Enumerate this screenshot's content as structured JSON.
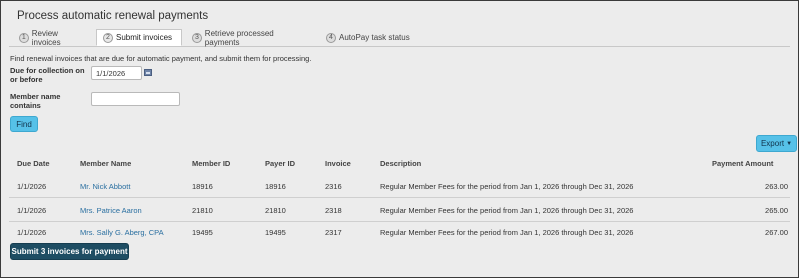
{
  "page": {
    "title": "Process automatic renewal payments",
    "intro": "Find renewal invoices that are due for automatic payment, and submit them for processing."
  },
  "tabs": [
    {
      "num": "1",
      "label": "Review invoices",
      "active": false
    },
    {
      "num": "2",
      "label": "Submit invoices",
      "active": true
    },
    {
      "num": "3",
      "label": "Retrieve processed payments",
      "active": false
    },
    {
      "num": "4",
      "label": "AutoPay task status",
      "active": false
    }
  ],
  "filters": {
    "due_label_line1": "Due for collection on",
    "due_label_line2": "or before",
    "due_value": "1/1/2026",
    "member_label_line1": "Member name",
    "member_label_line2": "contains",
    "member_value": "",
    "find_label": "Find"
  },
  "export_label": "Export",
  "table": {
    "headers": {
      "due_date": "Due Date",
      "member_name": "Member Name",
      "member_id": "Member ID",
      "payer_id": "Payer ID",
      "invoice": "Invoice",
      "description": "Description",
      "payment_amount": "Payment Amount"
    },
    "rows": [
      {
        "due_date": "1/1/2026",
        "member_name": "Mr. Nick Abbott",
        "member_id": "18916",
        "payer_id": "18916",
        "invoice": "2316",
        "description": "Regular Member Fees for the period from Jan 1, 2026 through Dec 31, 2026",
        "amount": "263.00"
      },
      {
        "due_date": "1/1/2026",
        "member_name": "Mrs. Patrice Aaron",
        "member_id": "21810",
        "payer_id": "21810",
        "invoice": "2318",
        "description": "Regular Member Fees for the period from Jan 1, 2026 through Dec 31, 2026",
        "amount": "265.00"
      },
      {
        "due_date": "1/1/2026",
        "member_name": "Mrs. Sally G. Aberg, CPA",
        "member_id": "19495",
        "payer_id": "19495",
        "invoice": "2317",
        "description": "Regular Member Fees for the period from Jan 1, 2026 through Dec 31, 2026",
        "amount": "267.00"
      }
    ]
  },
  "submit_label": "Submit 3 invoices for payment",
  "colors": {
    "accent_button": "#56c1e8",
    "primary_button": "#1e4d63",
    "link": "#2a6fa0",
    "background": "#ececec"
  },
  "icons": {
    "date_picker": "calendar-icon",
    "export_caret": "caret-down-icon"
  }
}
